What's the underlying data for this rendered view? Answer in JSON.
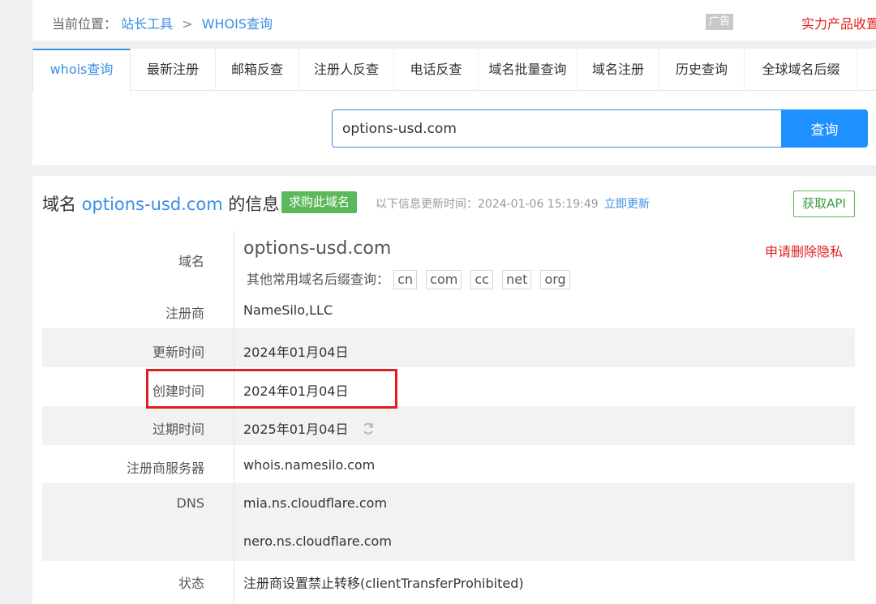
{
  "breadcrumb": {
    "prefix": "当前位置：",
    "link1": "站长工具",
    "separator": ">",
    "link2": "WHOIS查询"
  },
  "ad": {
    "badge": "广告",
    "promo": "实力产品收置"
  },
  "tabs": [
    {
      "label": "whois查询",
      "active": true
    },
    {
      "label": "最新注册"
    },
    {
      "label": "邮箱反查"
    },
    {
      "label": "注册人反查"
    },
    {
      "label": "电话反查"
    },
    {
      "label": "域名批量查询"
    },
    {
      "label": "域名注册"
    },
    {
      "label": "历史查询"
    },
    {
      "label": "全球域名后缀"
    }
  ],
  "search": {
    "value": "options-usd.com",
    "button": "查询"
  },
  "info": {
    "title_prefix": "域名",
    "title_domain": "options-usd.com",
    "title_suffix": "的信息",
    "buy_button": "求购此域名",
    "updated_text": "以下信息更新时间：2024-01-06 15:19:49",
    "refresh_link": "立即更新",
    "api_button": "获取API",
    "privacy_link": "申请删除隐私",
    "suffix_label": "其他常用域名后缀查询：",
    "suffixes": [
      "cn",
      "com",
      "cc",
      "net",
      "org"
    ]
  },
  "rows": {
    "domain": {
      "label": "域名",
      "value": "options-usd.com"
    },
    "registrar": {
      "label": "注册商",
      "value": "NameSilo,LLC"
    },
    "updated": {
      "label": "更新时间",
      "value": "2024年01月04日"
    },
    "created": {
      "label": "创建时间",
      "value": "2024年01月04日"
    },
    "expires": {
      "label": "过期时间",
      "value": "2025年01月04日"
    },
    "whois_server": {
      "label": "注册商服务器",
      "value": "whois.namesilo.com"
    },
    "dns": {
      "label": "DNS",
      "values": [
        "mia.ns.cloudflare.com",
        "nero.ns.cloudflare.com"
      ]
    },
    "status": {
      "label": "状态",
      "value": "注册商设置禁止转移(clientTransferProhibited)"
    }
  },
  "colors": {
    "accent": "#3a8ee6",
    "search_button": "#1e90ff",
    "buy_green": "#5cb85c",
    "highlight_red": "#e02020"
  }
}
